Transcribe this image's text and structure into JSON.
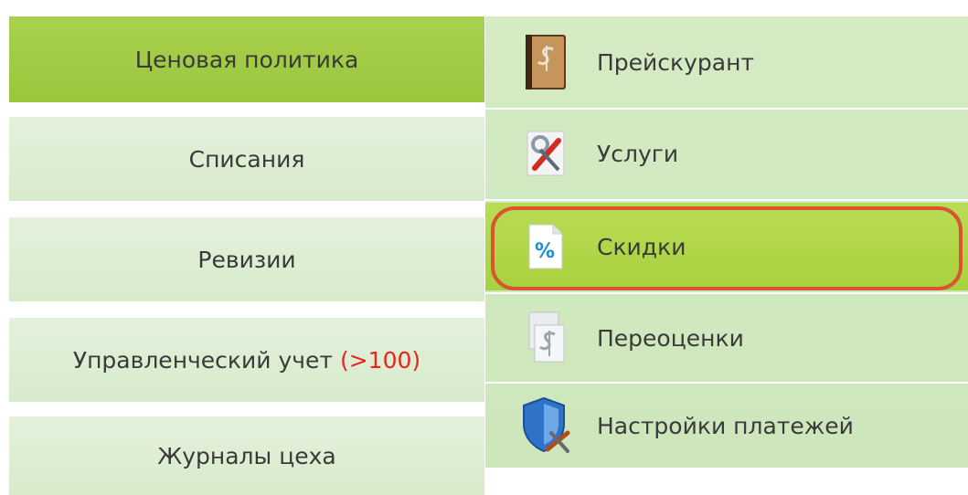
{
  "left_menu": {
    "items": [
      {
        "label": "Ценовая политика",
        "active": true
      },
      {
        "label": "Списания",
        "active": false
      },
      {
        "label": "Ревизии",
        "active": false
      },
      {
        "label": "Управленческий учет",
        "badge": "(>100)",
        "active": false
      },
      {
        "label": "Журналы цеха",
        "active": false
      }
    ]
  },
  "submenu": {
    "items": [
      {
        "label": "Прейскурант",
        "icon": "price-list-book-icon"
      },
      {
        "label": "Услуги",
        "icon": "services-tools-icon"
      },
      {
        "label": "Скидки",
        "icon": "discount-percent-icon",
        "selected": true
      },
      {
        "label": "Переоценки",
        "icon": "revaluation-dollar-icon"
      },
      {
        "label": "Настройки платежей",
        "icon": "payment-settings-shield-icon"
      }
    ]
  },
  "colors": {
    "active_green": "#9ac73e",
    "item_light_green": "#d7ebcb",
    "badge_red": "#e8241f",
    "highlight_ring": "#d9542f"
  }
}
